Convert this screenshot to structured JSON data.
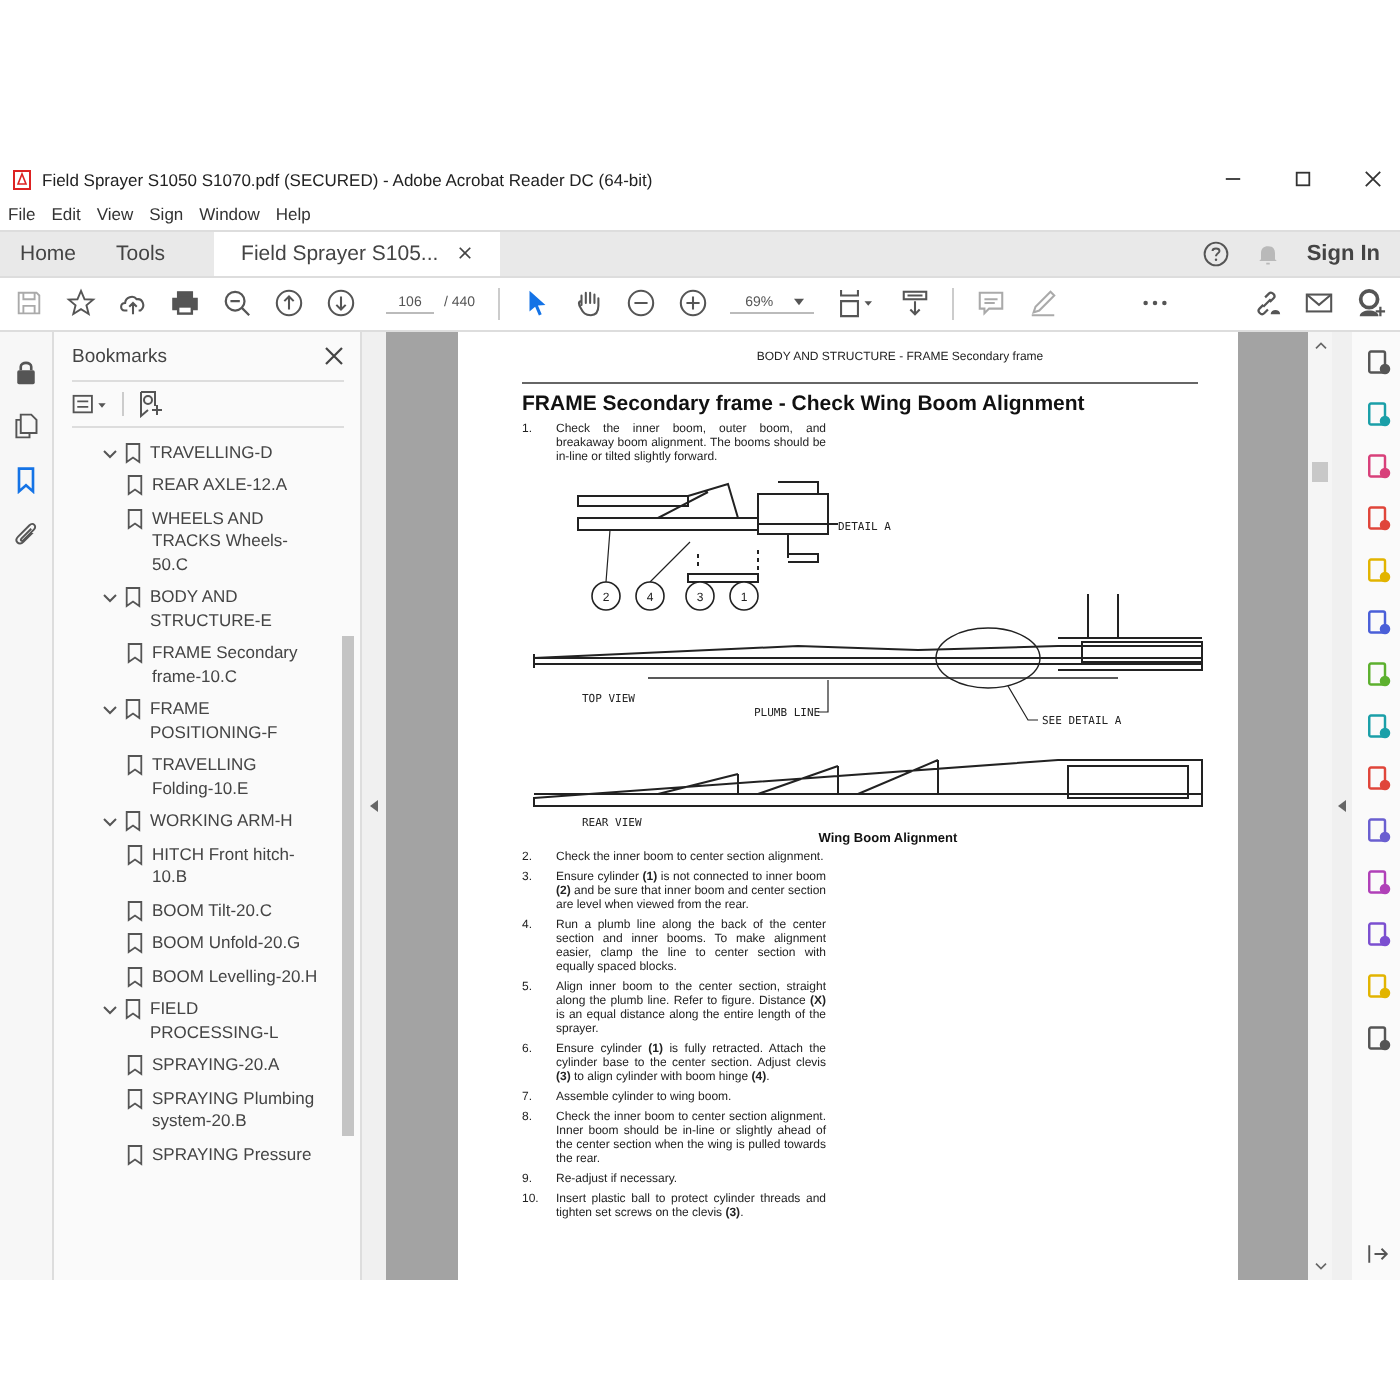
{
  "window": {
    "title": "Field Sprayer S1050 S1070.pdf (SECURED) - Adobe Acrobat Reader DC (64-bit)"
  },
  "menu": [
    "File",
    "Edit",
    "View",
    "Sign",
    "Window",
    "Help"
  ],
  "tabs": [
    {
      "label": "Home",
      "selected": false,
      "closable": false
    },
    {
      "label": "Tools",
      "selected": false,
      "closable": false
    },
    {
      "label": "Field Sprayer S105...",
      "selected": true,
      "closable": true
    }
  ],
  "account": {
    "sign_in": "Sign In"
  },
  "toolbar": {
    "page": "106",
    "page_total": "/ 440",
    "zoom": "69%",
    "tools": [
      {
        "kind": "select",
        "selected": true
      },
      {
        "kind": "hand",
        "selected": false
      }
    ]
  },
  "side_panel_buttons": [
    {
      "kind": "lock",
      "selected": false
    },
    {
      "kind": "pages",
      "selected": false
    },
    {
      "kind": "bookmarks",
      "selected": true
    },
    {
      "kind": "attachments",
      "selected": false
    }
  ],
  "bookmarks": {
    "title": "Bookmarks",
    "items": [
      {
        "label": "TRAVELLING-D",
        "expanded": true,
        "children": [
          {
            "label": "REAR AXLE-12.A"
          },
          {
            "label": "WHEELS AND TRACKS Wheels-50.C"
          }
        ]
      },
      {
        "label": "BODY AND STRUCTURE-E",
        "expanded": true,
        "children": [
          {
            "label": "FRAME Secondary frame-10.C"
          }
        ]
      },
      {
        "label": "FRAME POSITIONING-F",
        "expanded": true,
        "children": [
          {
            "label": "TRAVELLING Folding-10.E"
          }
        ]
      },
      {
        "label": "WORKING ARM-H",
        "expanded": true,
        "children": [
          {
            "label": "HITCH Front hitch-10.B"
          },
          {
            "label": "BOOM Tilt-20.C"
          },
          {
            "label": "BOOM Unfold-20.G"
          },
          {
            "label": "BOOM Levelling-20.H"
          }
        ]
      },
      {
        "label": "FIELD PROCESSING-L",
        "expanded": true,
        "children": [
          {
            "label": "SPRAYING-20.A"
          },
          {
            "label": "SPRAYING Plumbing system-20.B"
          },
          {
            "label": "SPRAYING Pressure"
          }
        ]
      }
    ]
  },
  "document": {
    "running_header": "BODY AND STRUCTURE - FRAME Secondary frame",
    "heading": "FRAME Secondary frame - Check Wing Boom Alignment",
    "steps_before": [
      {
        "number": "1.",
        "text": "Check the inner boom, outer boom, and breakaway boom alignment. The booms should be in-line or tilted slightly forward."
      }
    ],
    "figure": {
      "callouts": [
        "2",
        "4",
        "3",
        "1"
      ],
      "labels": {
        "detail": "DETAIL A",
        "top_view": "TOP VIEW",
        "plumb_line": "PLUMB LINE",
        "see_detail": "SEE DETAIL A",
        "rear_view": "REAR VIEW"
      },
      "caption": "Wing Boom Alignment"
    },
    "steps_after": [
      {
        "number": "2.",
        "text": "Check the inner boom to center section alignment."
      },
      {
        "number": "3.",
        "text": "Ensure cylinder **(1)** is not connected to inner boom **(2)** and be sure that inner boom and center section are level when viewed from the rear."
      },
      {
        "number": "4.",
        "text": "Run a plumb line along the back of the center section and inner booms. To make alignment easier, clamp the line to center section with equally spaced blocks."
      },
      {
        "number": "5.",
        "text": "Align inner boom to the center section, straight along the plumb line. Refer to figure. Distance **(X)** is an equal distance along the entire length of the sprayer."
      },
      {
        "number": "6.",
        "text": "Ensure cylinder **(1)** is fully retracted. Attach the cylinder base to the center section. Adjust clevis **(3)** to align cylinder with boom hinge **(4)**."
      },
      {
        "number": "7.",
        "text": "Assemble cylinder to wing boom."
      },
      {
        "number": "8.",
        "text": "Check the inner boom to center section alignment. Inner boom should be in-line or slightly ahead of the center section when the wing is pulled towards the rear."
      },
      {
        "number": "9.",
        "text": "Re-adjust if necessary."
      },
      {
        "number": "10.",
        "text": "Insert plastic ball to protect cylinder threads and tighten set screws on the clevis **(3)**."
      }
    ]
  }
}
